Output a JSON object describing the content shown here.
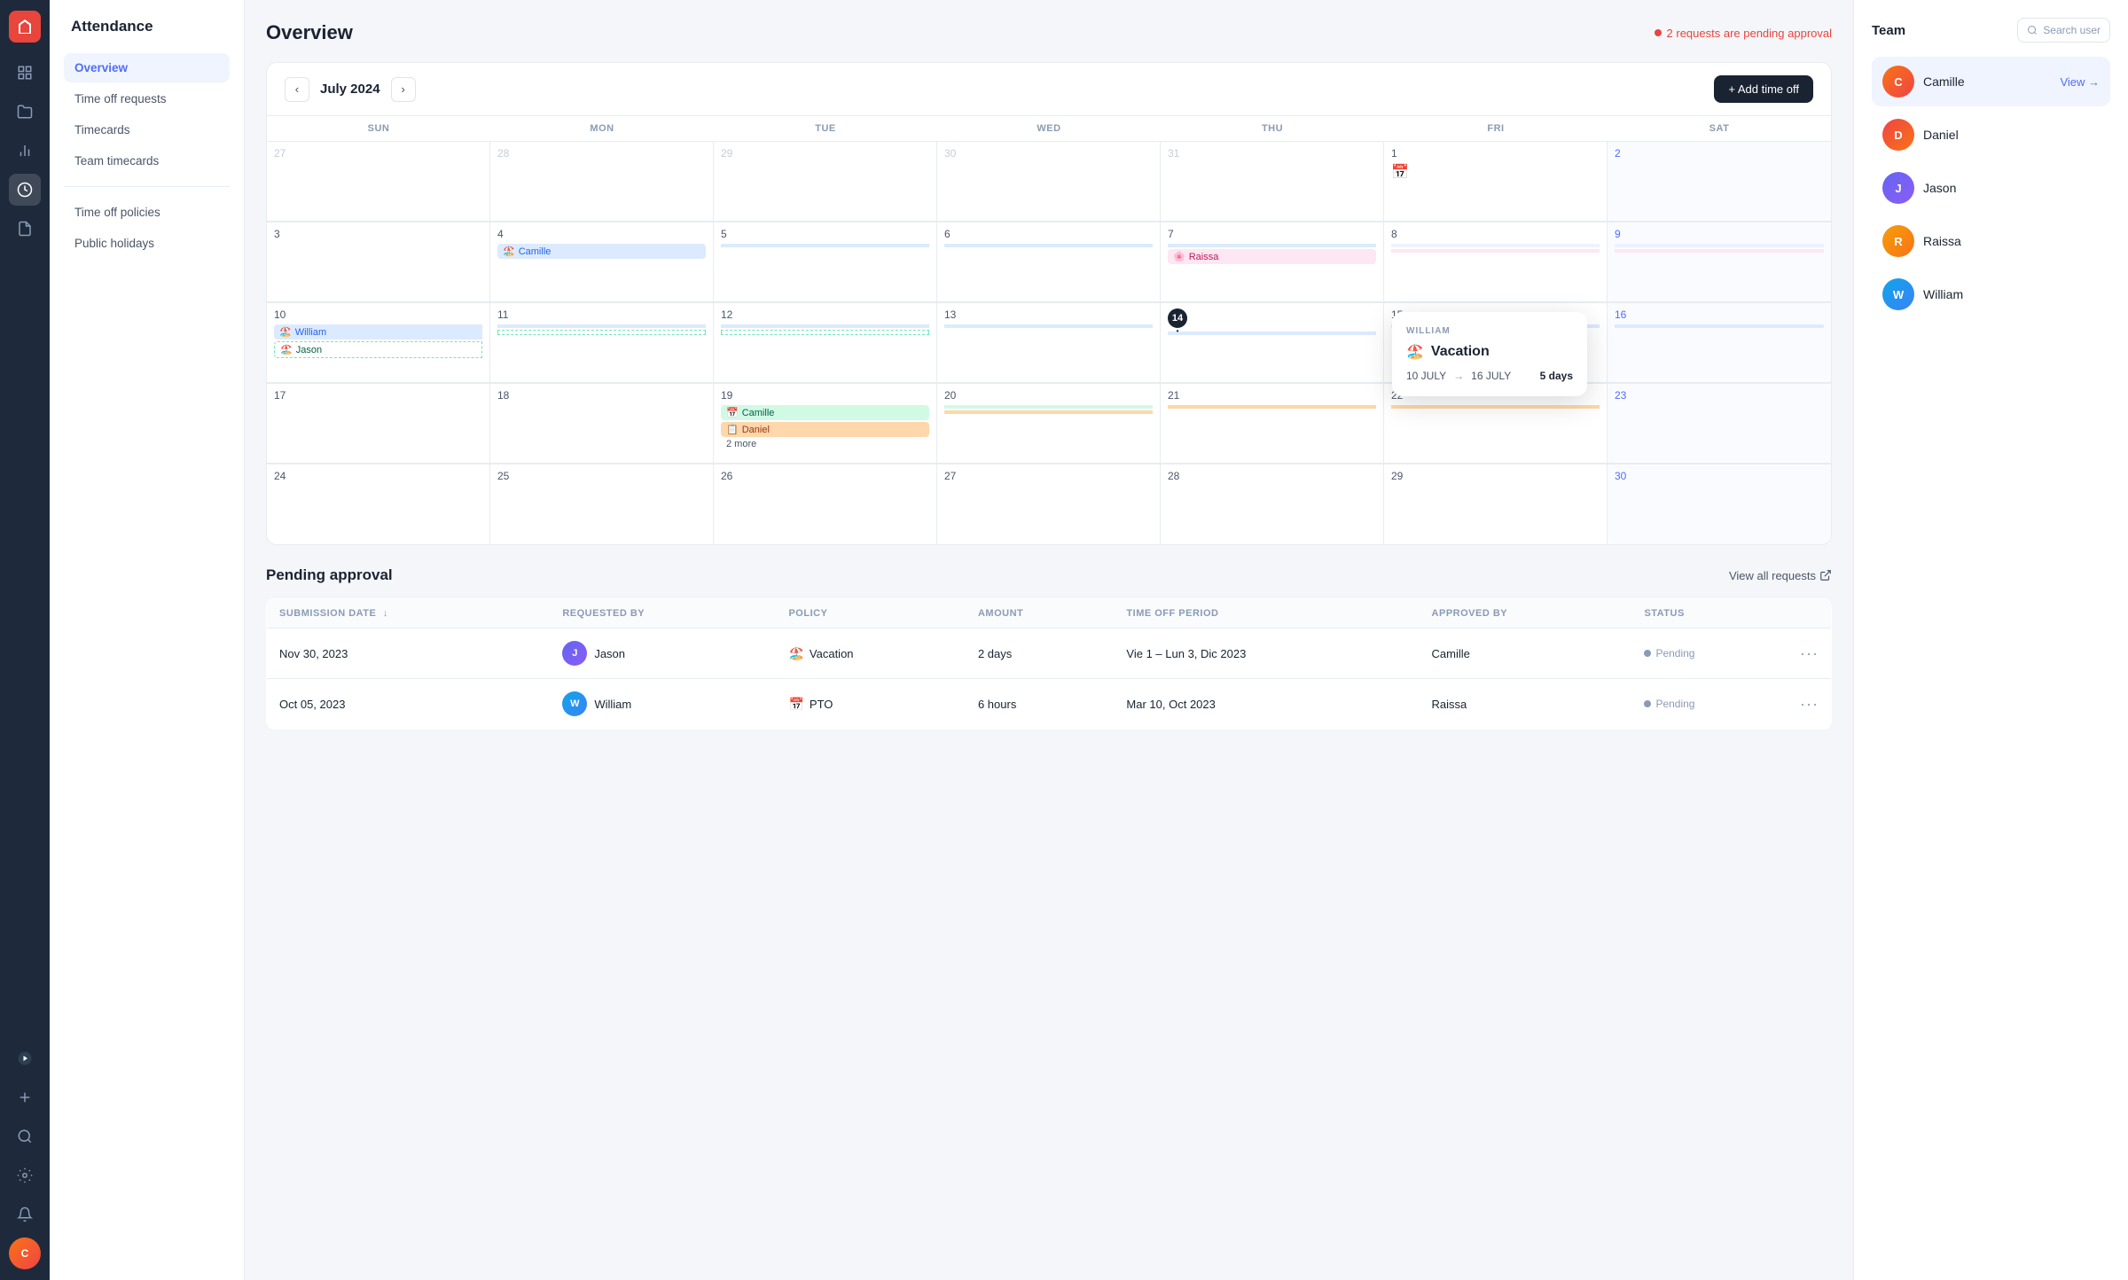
{
  "app": {
    "title": "Attendance"
  },
  "sidebar": {
    "title": "Attendance",
    "nav_items": [
      {
        "id": "overview",
        "label": "Overview",
        "active": true
      },
      {
        "id": "time-off-requests",
        "label": "Time off requests",
        "active": false
      },
      {
        "id": "timecards",
        "label": "Timecards",
        "active": false
      },
      {
        "id": "team-timecards",
        "label": "Team timecards",
        "active": false
      },
      {
        "id": "time-off-policies",
        "label": "Time off policies",
        "active": false
      },
      {
        "id": "public-holidays",
        "label": "Public holidays",
        "active": false
      }
    ]
  },
  "header": {
    "title": "Overview",
    "pending_text": "2 requests are pending approval",
    "month": "July 2024",
    "add_button": "+ Add time off"
  },
  "calendar": {
    "day_headers": [
      "SUN",
      "MON",
      "TUE",
      "WED",
      "THU",
      "FRI",
      "SAT"
    ],
    "weeks": [
      {
        "days": [
          {
            "num": "27",
            "other": true
          },
          {
            "num": "28",
            "other": true
          },
          {
            "num": "29",
            "other": true
          },
          {
            "num": "30",
            "other": true
          },
          {
            "num": "31",
            "other": true
          },
          {
            "num": "1"
          },
          {
            "num": "2",
            "weekend": true
          }
        ]
      },
      {
        "days": [
          {
            "num": "3"
          },
          {
            "num": "4"
          },
          {
            "num": "5"
          },
          {
            "num": "6"
          },
          {
            "num": "7"
          },
          {
            "num": "8"
          },
          {
            "num": "9",
            "weekend": true
          }
        ]
      },
      {
        "days": [
          {
            "num": "10"
          },
          {
            "num": "11"
          },
          {
            "num": "12"
          },
          {
            "num": "13"
          },
          {
            "num": "14",
            "today": true
          },
          {
            "num": "15"
          },
          {
            "num": "16",
            "weekend": true
          }
        ]
      },
      {
        "days": [
          {
            "num": "17"
          },
          {
            "num": "18"
          },
          {
            "num": "19"
          },
          {
            "num": "20"
          },
          {
            "num": "21"
          },
          {
            "num": "22"
          },
          {
            "num": "23",
            "weekend": true
          }
        ]
      },
      {
        "days": [
          {
            "num": "24"
          },
          {
            "num": "25"
          },
          {
            "num": "26"
          },
          {
            "num": "27"
          },
          {
            "num": "28"
          },
          {
            "num": "29"
          },
          {
            "num": "30",
            "weekend": true
          }
        ]
      }
    ]
  },
  "tooltip": {
    "user": "WILLIAM",
    "type": "Vacation",
    "from": "10 JULY",
    "to": "16 JULY",
    "days": "5 days",
    "arrow": "→"
  },
  "team": {
    "label": "Team",
    "search_placeholder": "Search user",
    "members": [
      {
        "name": "Camille",
        "active": true,
        "view_label": "View →"
      },
      {
        "name": "Daniel",
        "active": false
      },
      {
        "name": "Jason",
        "active": false
      },
      {
        "name": "Raissa",
        "active": false
      },
      {
        "name": "William",
        "active": false
      }
    ]
  },
  "pending": {
    "title": "Pending approval",
    "view_all": "View all requests",
    "columns": [
      {
        "id": "submission_date",
        "label": "SUBMISSION DATE",
        "sortable": true
      },
      {
        "id": "requested_by",
        "label": "REQUESTED BY"
      },
      {
        "id": "policy",
        "label": "POLICY"
      },
      {
        "id": "amount",
        "label": "AMOUNT"
      },
      {
        "id": "time_off_period",
        "label": "TIME OFF PERIOD"
      },
      {
        "id": "approved_by",
        "label": "APPROVED BY"
      },
      {
        "id": "status",
        "label": "STATUS"
      }
    ],
    "rows": [
      {
        "submission_date": "Nov 30, 2023",
        "requested_by": "Jason",
        "policy": "Vacation",
        "policy_icon": "🏖️",
        "amount": "2 days",
        "time_off_period": "Vie 1 – Lun 3, Dic 2023",
        "approved_by": "Camille",
        "status": "Pending"
      },
      {
        "submission_date": "Oct 05, 2023",
        "requested_by": "William",
        "policy": "PTO",
        "policy_icon": "📅",
        "amount": "6 hours",
        "time_off_period": "Mar 10, Oct 2023",
        "approved_by": "Raissa",
        "status": "Pending"
      }
    ]
  }
}
